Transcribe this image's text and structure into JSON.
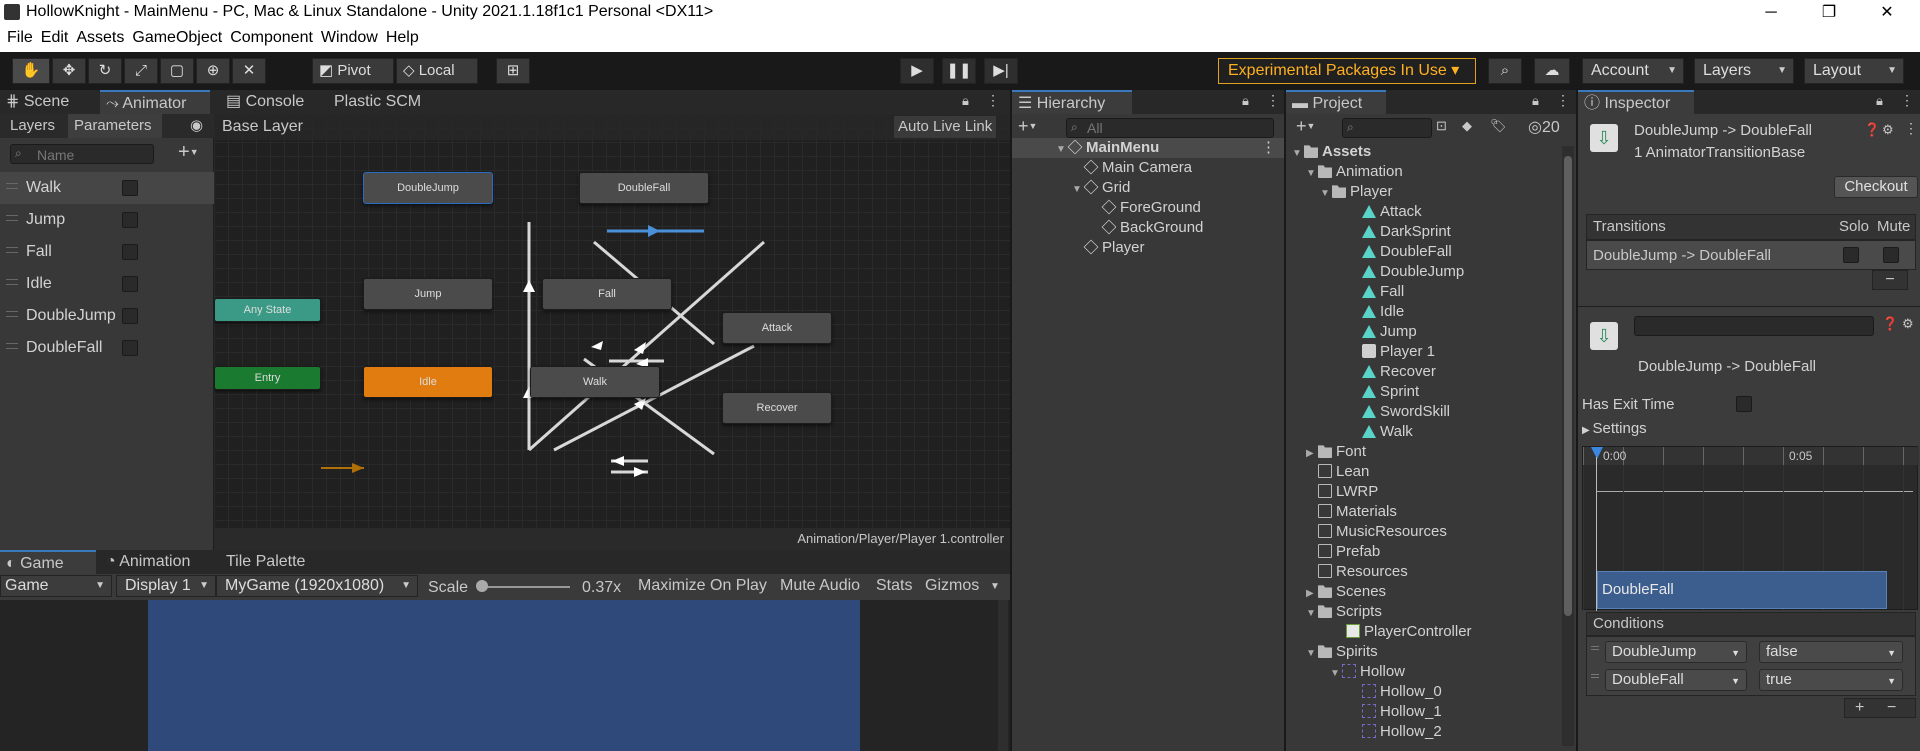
{
  "window": {
    "title": "HollowKnight - MainMenu - PC, Mac & Linux Standalone - Unity 2021.1.18f1c1 Personal <DX11>",
    "min": "─",
    "max": "❐",
    "close": "✕"
  },
  "menu": [
    "File",
    "Edit",
    "Assets",
    "GameObject",
    "Component",
    "Window",
    "Help"
  ],
  "toolbar": {
    "pivot": "Pivot",
    "local": "Local",
    "experimental": "Experimental Packages In Use ▾",
    "account": "Account",
    "layers": "Layers",
    "layout": "Layout"
  },
  "scene_tabs": {
    "scene": "Scene",
    "animator": "Animator",
    "console": "Console",
    "plastic": "Plastic SCM"
  },
  "animator": {
    "sub_tabs": {
      "layers": "Layers",
      "parameters": "Parameters"
    },
    "search_placeholder": "Name",
    "breadcrumb": "Base Layer",
    "auto_live": "Auto Live Link",
    "params": [
      "Walk",
      "Jump",
      "Fall",
      "Idle",
      "DoubleJump",
      "DoubleFall"
    ],
    "states": {
      "doublejump": "DoubleJump",
      "doublefall": "DoubleFall",
      "jump": "Jump",
      "fall": "Fall",
      "anystate": "Any State",
      "entry": "Entry",
      "idle": "Idle",
      "walk": "Walk",
      "attack": "Attack",
      "recover": "Recover"
    },
    "path": "Animation/Player/Player 1.controller"
  },
  "game": {
    "tabs": {
      "game": "Game",
      "animation": "Animation",
      "tile": "Tile Palette"
    },
    "mode": "Game",
    "display": "Display 1",
    "resolution": "MyGame (1920x1080)",
    "scale_label": "Scale",
    "scale_value": "0.37x",
    "maximize": "Maximize On Play",
    "mute": "Mute Audio",
    "stats": "Stats",
    "gizmos": "Gizmos",
    "view_color": "#2f4a7a"
  },
  "hierarchy": {
    "tab": "Hierarchy",
    "search_placeholder": "All",
    "items": [
      {
        "label": "MainMenu"
      },
      {
        "label": "Main Camera"
      },
      {
        "label": "Grid"
      },
      {
        "label": "ForeGround"
      },
      {
        "label": "BackGround"
      },
      {
        "label": "Player"
      }
    ]
  },
  "project": {
    "tab": "Project",
    "count": "20",
    "items": [
      "Assets",
      "Animation",
      "Player",
      "Attack",
      "DarkSprint",
      "DoubleFall",
      "DoubleJump",
      "Fall",
      "Idle",
      "Jump",
      "Player 1",
      "Recover",
      "Sprint",
      "SwordSkill",
      "Walk",
      "Font",
      "Lean",
      "LWRP",
      "Materials",
      "MusicResources",
      "Prefab",
      "Resources",
      "Scenes",
      "Scripts",
      "PlayerController",
      "Spirits",
      "Hollow",
      "Hollow_0",
      "Hollow_1",
      "Hollow_2"
    ]
  },
  "inspector": {
    "tab": "Inspector",
    "title": "DoubleJump -> DoubleFall",
    "subtitle": "1 AnimatorTransitionBase",
    "checkout": "Checkout",
    "transitions_header": "Transitions",
    "solo": "Solo",
    "mute": "Mute",
    "transition_row": "DoubleJump -> DoubleFall",
    "minus": "−",
    "transition_name": "DoubleJump -> DoubleFall",
    "has_exit": "Has Exit Time",
    "settings": "Settings",
    "timeline_start": "0:00",
    "timeline_mid": "0:05",
    "clip_bar": "DoubleFall",
    "conditions_header": "Conditions",
    "conditions": [
      {
        "param": "DoubleJump",
        "value": "false"
      },
      {
        "param": "DoubleFall",
        "value": "true"
      }
    ],
    "plus": "+"
  },
  "colors": {
    "idle": "#e07c10",
    "entry": "#1a7a2f",
    "any": "#3a9a86",
    "link": "#4a90d9"
  }
}
